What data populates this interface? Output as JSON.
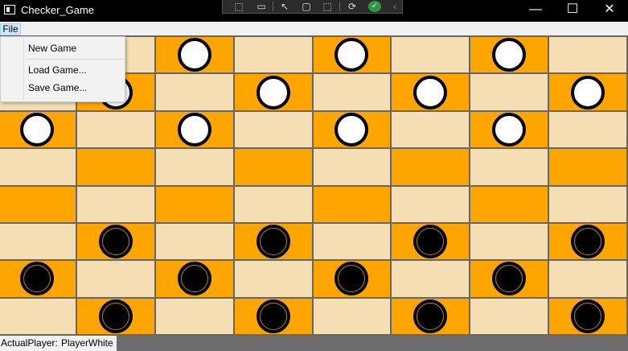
{
  "window": {
    "title": "Checker_Game",
    "icon": "app-window-icon",
    "controls": {
      "minimize": "—",
      "maximize": "☐",
      "close": "✕"
    }
  },
  "debug_toolbar": {
    "icons": [
      "select-element-icon",
      "record-icon",
      "pointer-icon",
      "frame-icon",
      "inspect-icon",
      "hot-reload-icon",
      "check-icon",
      "collapse-icon"
    ]
  },
  "menu": {
    "file_label": "File",
    "items": [
      "New Game",
      "Load Game...",
      "Save Game..."
    ]
  },
  "board": {
    "colors": {
      "dark": "#ffa500",
      "light": "#f5deb3",
      "grid": "#666666"
    },
    "cells": [
      "DW",
      "L",
      "DW",
      "L",
      "DW",
      "L",
      "DW",
      "L",
      "L",
      "DW",
      "L",
      "DW",
      "L",
      "DW",
      "L",
      "DW",
      "DW",
      "L",
      "DW",
      "L",
      "DW",
      "L",
      "DW",
      "L",
      "L",
      "D",
      "L",
      "D",
      "L",
      "D",
      "L",
      "D",
      "D",
      "L",
      "D",
      "L",
      "D",
      "L",
      "D",
      "L",
      "L",
      "DB",
      "L",
      "DB",
      "L",
      "DB",
      "L",
      "DB",
      "DB",
      "L",
      "DB",
      "L",
      "DB",
      "L",
      "DB",
      "L",
      "L",
      "DB",
      "L",
      "DB",
      "L",
      "DB",
      "L",
      "DB"
    ]
  },
  "status": {
    "label": "ActualPlayer:",
    "value": "PlayerWhite"
  }
}
